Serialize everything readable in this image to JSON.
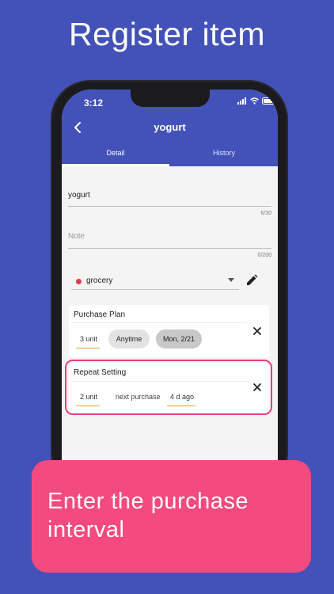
{
  "headline": "Register item",
  "status_bar": {
    "time": "3:12"
  },
  "app_bar": {
    "title": "yogurt"
  },
  "tabs": [
    {
      "label": "Detail",
      "active": true
    },
    {
      "label": "History",
      "active": false
    }
  ],
  "form": {
    "name_value": "yogurt",
    "name_counter": "6/30",
    "note_placeholder": "Note",
    "note_counter": "0/200"
  },
  "category": {
    "label": "grocery",
    "dot_color": "#e53950"
  },
  "purchase_plan": {
    "title": "Purchase Plan",
    "units": "3 unit",
    "chip_anytime": "Anytime",
    "chip_date": "Mon, 2/21"
  },
  "repeat_setting": {
    "title": "Repeat Setting",
    "units": "2 unit",
    "next_label": "next purchase",
    "next_value": "4 d ago"
  },
  "callout": {
    "text": "Enter the purchase interval"
  },
  "colors": {
    "brand": "#4352b8",
    "accent_pink": "#f44a7f",
    "underline_orange": "#f0a23a"
  },
  "icons": {
    "back": "chevron-left-icon",
    "edit": "pencil-icon",
    "close": "close-icon",
    "dropdown": "caret-down-icon",
    "signal": "signal-icon",
    "wifi": "wifi-icon",
    "battery": "battery-icon"
  }
}
